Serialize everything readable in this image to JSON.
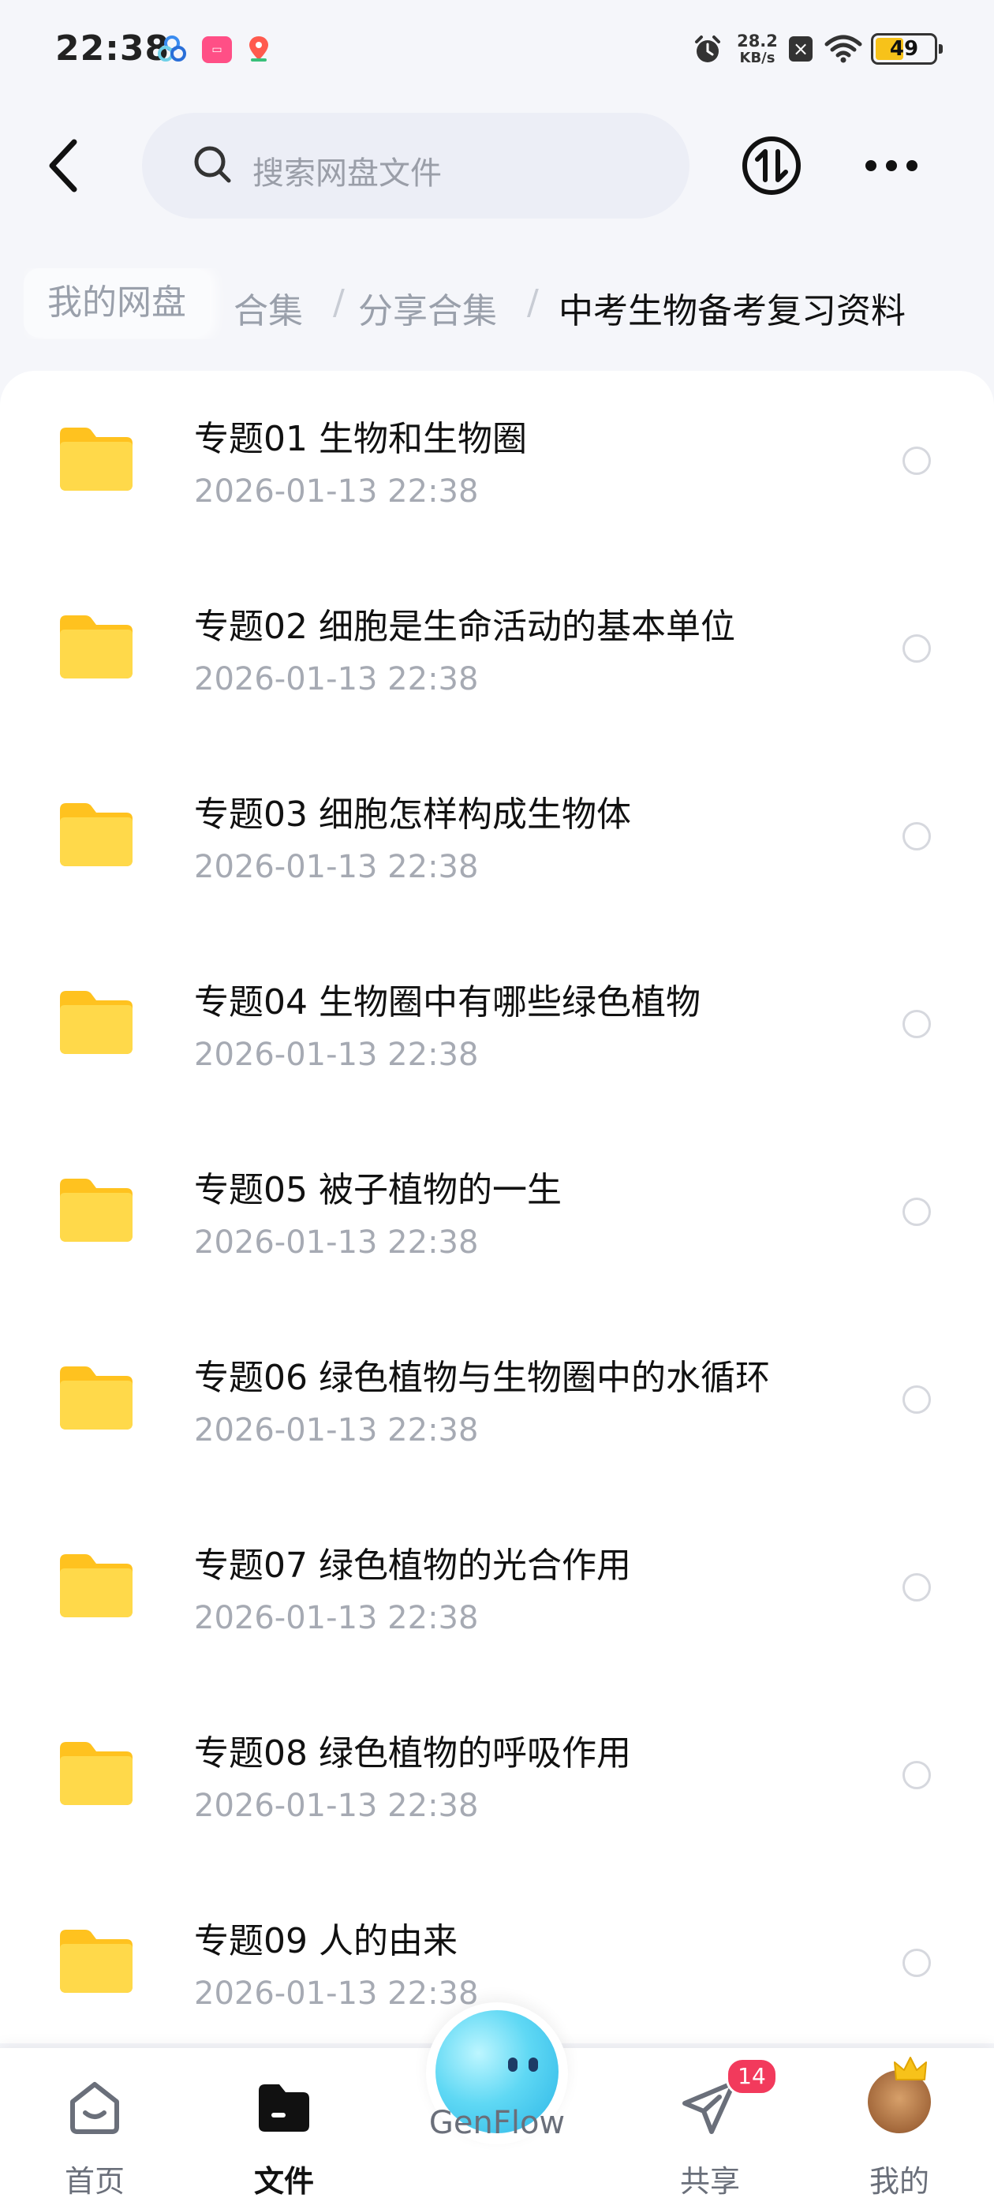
{
  "status_bar": {
    "time": "22:38",
    "net_speed_value": "28.2",
    "net_speed_unit": "KB/s",
    "battery": "49",
    "battery_level": 0.49
  },
  "header": {
    "search_placeholder": "搜索网盘文件"
  },
  "breadcrumb": {
    "home": "我的网盘",
    "partial": "合集",
    "items": [
      "分享合集",
      "中考生物备考复习资料"
    ],
    "separator": "/"
  },
  "files": [
    {
      "name": "专题01 生物和生物圈",
      "date": "2026-01-13  22:38"
    },
    {
      "name": "专题02 细胞是生命活动的基本单位",
      "date": "2026-01-13  22:38"
    },
    {
      "name": "专题03 细胞怎样构成生物体",
      "date": "2026-01-13  22:38"
    },
    {
      "name": "专题04 生物圈中有哪些绿色植物",
      "date": "2026-01-13  22:38"
    },
    {
      "name": "专题05 被子植物的一生",
      "date": "2026-01-13  22:38"
    },
    {
      "name": "专题06 绿色植物与生物圈中的水循环",
      "date": "2026-01-13  22:38"
    },
    {
      "name": "专题07 绿色植物的光合作用",
      "date": "2026-01-13  22:38"
    },
    {
      "name": "专题08 绿色植物的呼吸作用",
      "date": "2026-01-13  22:38"
    },
    {
      "name": "专题09 人的由来",
      "date": "2026-01-13  22:38"
    }
  ],
  "bottom_nav": {
    "home": "首页",
    "files": "文件",
    "genflow": "GenFlow",
    "share": "共享",
    "share_badge": "14",
    "me": "我的"
  },
  "colors": {
    "folder": "#ffcf3a",
    "accent_badge": "#f23a5c"
  }
}
